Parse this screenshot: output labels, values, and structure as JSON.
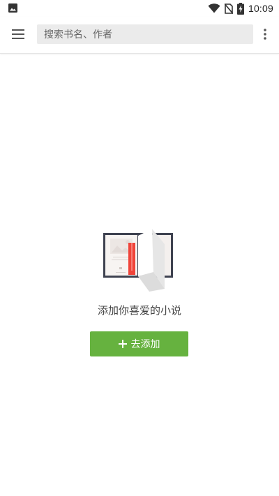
{
  "status_bar": {
    "time": "10:09",
    "icons": [
      "photo-icon",
      "wifi-icon",
      "no-sim-icon",
      "battery-charging-icon"
    ]
  },
  "app_bar": {
    "menu_icon": "menu-icon",
    "search": {
      "placeholder": "搜索书名、作者",
      "value": ""
    },
    "more_icon": "more-vert-icon"
  },
  "empty_state": {
    "illustration": "open-book-illustration",
    "message": "添加你喜爱的小说",
    "button": {
      "icon": "plus-icon",
      "label": "去添加"
    }
  },
  "colors": {
    "accent_green": "#66b23f",
    "bookmark_red": "#f0443a",
    "search_bg": "#ebebeb",
    "text_secondary": "#444444"
  }
}
